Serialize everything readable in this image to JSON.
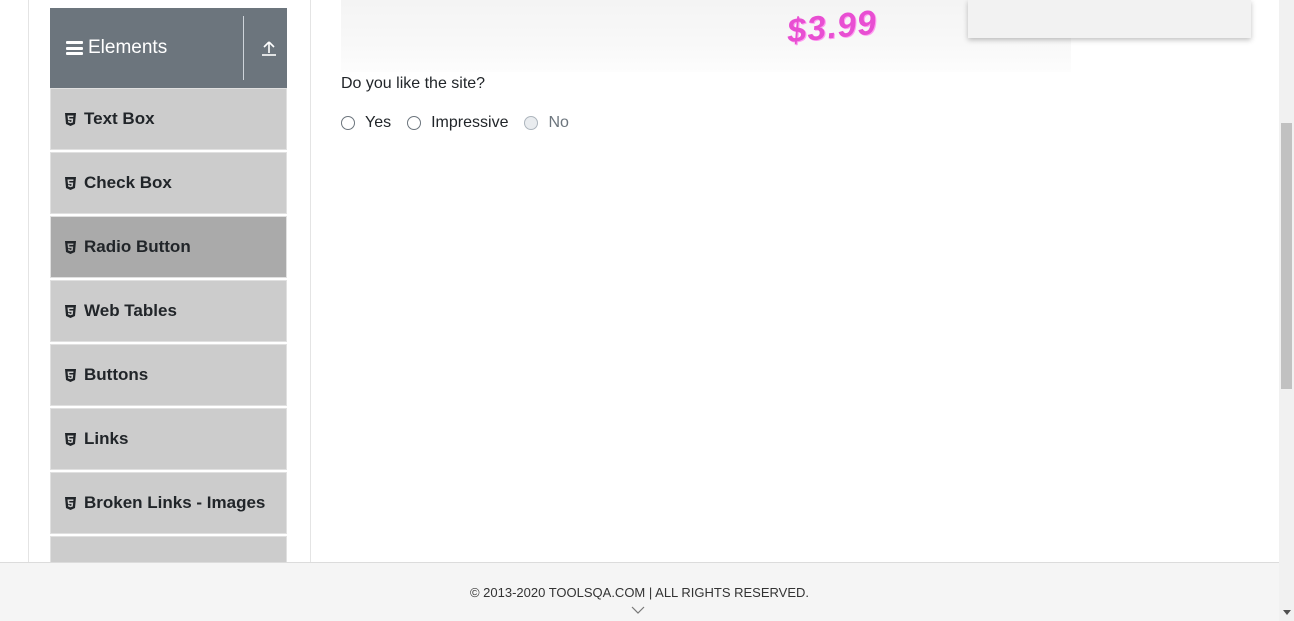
{
  "sidebar": {
    "group_title": "Elements",
    "items": [
      {
        "label": "Text Box",
        "active": false
      },
      {
        "label": "Check Box",
        "active": false
      },
      {
        "label": "Radio Button",
        "active": true
      },
      {
        "label": "Web Tables",
        "active": false
      },
      {
        "label": "Buttons",
        "active": false
      },
      {
        "label": "Links",
        "active": false
      },
      {
        "label": "Broken Links - Images",
        "active": false
      }
    ]
  },
  "banner": {
    "price": "$3.99"
  },
  "main": {
    "question": "Do you like the site?",
    "radios": [
      {
        "label": "Yes",
        "disabled": false
      },
      {
        "label": "Impressive",
        "disabled": false
      },
      {
        "label": "No",
        "disabled": true
      }
    ]
  },
  "footer": {
    "copyright": "© 2013-2020 TOOLSQA.COM | ALL RIGHTS RESERVED."
  },
  "colors": {
    "group_header_bg": "#6c757d",
    "menu_item_bg": "#cccccc",
    "menu_item_active_bg": "#aaaaaa",
    "price_color": "#e84fd2"
  }
}
